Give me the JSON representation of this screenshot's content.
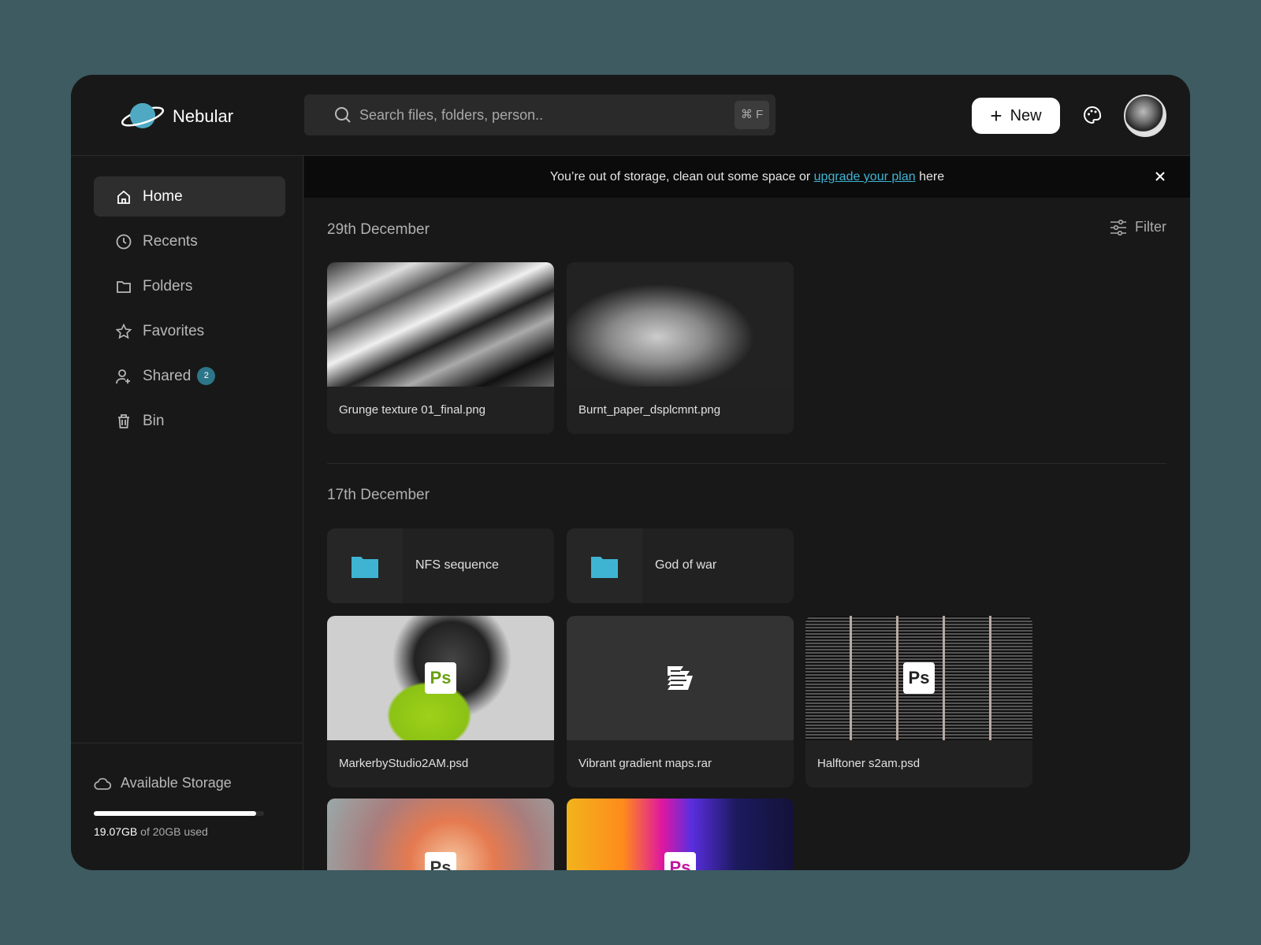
{
  "app": {
    "name": "Nebular",
    "accent": "#3fb4d2"
  },
  "search": {
    "placeholder": "Search files, folders, person..",
    "shortcut": "⌘ F"
  },
  "header": {
    "new_label": "New",
    "icons": [
      "palette-icon",
      "avatar"
    ]
  },
  "sidebar": {
    "items": [
      {
        "label": "Home",
        "icon": "home-icon",
        "active": true
      },
      {
        "label": "Recents",
        "icon": "clock-icon"
      },
      {
        "label": "Folders",
        "icon": "folder-icon"
      },
      {
        "label": "Favorites",
        "icon": "star-icon"
      },
      {
        "label": "Shared",
        "icon": "user-plus-icon",
        "badge": "2"
      },
      {
        "label": "Bin",
        "icon": "trash-icon"
      }
    ]
  },
  "storage": {
    "title": "Available Storage",
    "used": "19.07GB",
    "suffix": "of 20GB used",
    "percent": 95.35
  },
  "banner": {
    "pre": "You’re out of storage, clean out some space or ",
    "link": "upgrade your plan",
    "post": " here"
  },
  "filter_label": "Filter",
  "sections": [
    {
      "title": "29th December",
      "files": [
        {
          "name": "Grunge texture 01_final.png"
        },
        {
          "name": "Burnt_paper_dsplcmnt.png"
        }
      ]
    },
    {
      "title": "17th December",
      "folders": [
        {
          "name": "NFS sequence"
        },
        {
          "name": "God of war"
        }
      ],
      "files": [
        {
          "name": "MarkerbyStudio2AM.psd",
          "badge": "Ps"
        },
        {
          "name": "Vibrant gradient maps.rar"
        },
        {
          "name": "Halftoner s2am.psd",
          "badge": "Ps"
        },
        {
          "name": "",
          "badge": "Ps"
        },
        {
          "name": "",
          "badge": "Ps"
        }
      ]
    }
  ]
}
